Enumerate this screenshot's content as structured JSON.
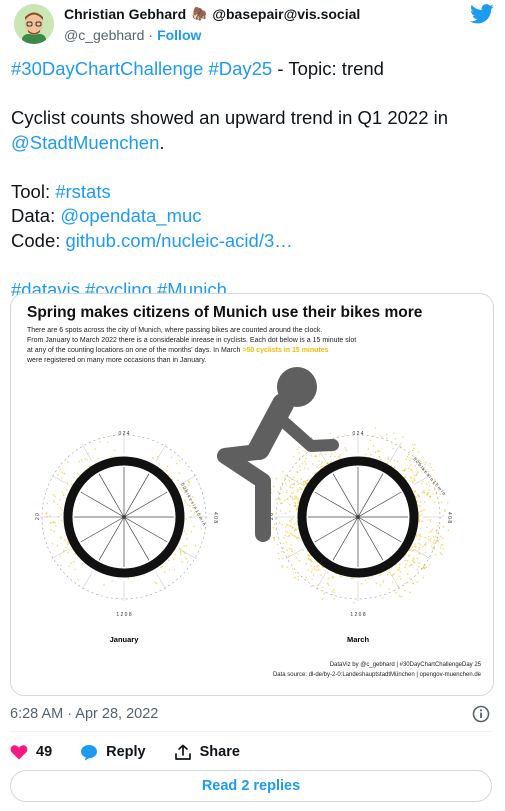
{
  "author": {
    "name": "Christian Gebhard",
    "emoji": "🦣",
    "mastodon": "@basepair@vis.social",
    "handle": "@c_gebhard",
    "separator": "·",
    "follow_label": "Follow"
  },
  "tweet": {
    "line1_tags": "#30DayChartChallenge #Day25",
    "line1_rest": " - Topic: trend",
    "line2_text": "Cyclist counts showed an upward trend in Q1 2022 in",
    "line2_mention": "@StadtMuenchen",
    "line2_end": ".",
    "tool_label": "Tool: ",
    "tool_value": "#rstats",
    "data_label": "Data: ",
    "data_value": "@opendata_muc",
    "code_label": "Code: ",
    "code_value": "github.com/nucleic-acid/3…",
    "hashtags": "#datavis #cycling #Munich"
  },
  "card": {
    "title": "Spring makes citizens of Munich use their bikes more",
    "desc_1": "There are 6 spots across the city of Munich, where passing bikes are counted around the clock.",
    "desc_2": "From January to March 2022 there is a considerable inrease in cyclists. Each dot below is a 15 minute slot",
    "desc_3": "at any of the counting locations on one of the months' days. In March ",
    "desc_highlight": ">50 cyclists in 15 minutes",
    "desc_4": "were registered on many more occasions than in January.",
    "left_wheel_label": "January",
    "right_wheel_label": "March",
    "credit_1": "DataViz by @c_gebhard | #30DayChartChallengeDay 25",
    "credit_2": "Data source: dl-de/by-2-0:LandeshauptstadtMünchen | opengov-muenchen.de",
    "ring_label": "5 0   b i k e s   i n   1 5   m i n",
    "hours_top": "0 2 4",
    "hours_bottom": "1 2 0 8",
    "hours_left": "2 0",
    "hours_right": "4 0 8"
  },
  "meta": {
    "timestamp": "6:28 AM · Apr 28, 2022",
    "likes": "49",
    "reply_label": "Reply",
    "share_label": "Share",
    "read_replies": "Read 2 replies"
  },
  "colors": {
    "accent": "#1d9bf0",
    "like": "#f91880",
    "highlight": "#f5b800",
    "bike": "#5f5f5f"
  }
}
